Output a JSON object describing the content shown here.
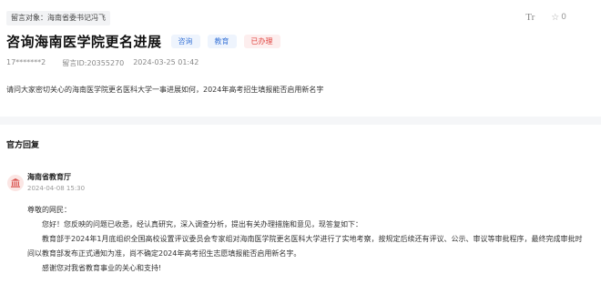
{
  "header": {
    "target_tag": "留言对象：海南省委书记冯飞",
    "font_tool": "Tr",
    "star_count": "0",
    "title": "咨询海南医学院更名进展",
    "tags": [
      "咨询",
      "教育",
      "已办理"
    ],
    "author": "17*******2",
    "message_id": "留言ID:20355270",
    "time": "2024-03-25 01:42",
    "question": "请问大家密切关心的海南医学院更名医科大学一事进展如何，2024年高考招生填报能否启用新名字"
  },
  "reply": {
    "section_title": "官方回复",
    "org": "海南省教育厅",
    "time": "2024-04-08 15:30",
    "greeting": "尊敬的网民：",
    "p1": "您好！您反映的问题已收悉，经认真研究，深入调查分析，提出有关办理措施和意见，现答复如下：",
    "p2a": "教育部于2024年1月底组织全国高校设置评议委员会专家组对海南医学院更名医科大学进行了实地考察，按规定后续还有评议、公示、审议等审批程序，最终完成审批时",
    "p2b": "间以教育部发布正式通知为准，尚不确定2024年高考招生志愿填报能否启用新名字。",
    "p3": "感谢您对我省教育事业的关心和支持!"
  },
  "colors": {
    "tag_blue": "#3f78d8",
    "tag_red": "#e0413c",
    "avatar_bg": "#fbe6e4",
    "avatar_icon": "#d9534f"
  }
}
